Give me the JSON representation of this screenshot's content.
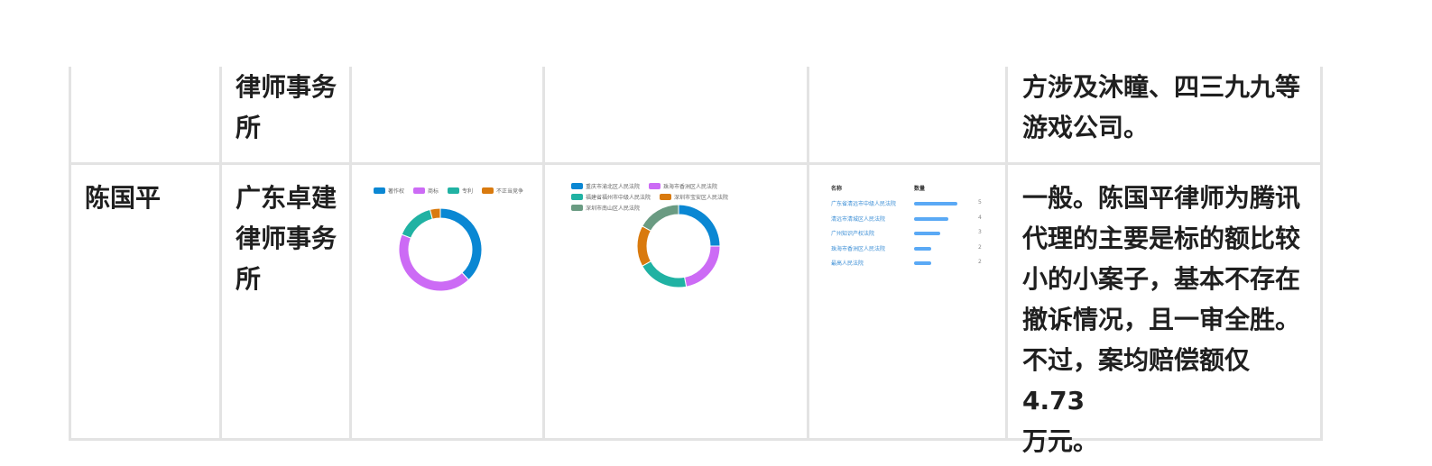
{
  "row_partial": {
    "firm_lines": [
      "律师事务",
      "所"
    ],
    "note_lines": [
      "方涉及沐瞳、四三九九等",
      "游戏公司。"
    ]
  },
  "row_main": {
    "name": "陈国平",
    "firm_lines": [
      "广东卓建",
      "律师事务",
      "所"
    ],
    "note_lines": [
      "一般。陈国平律师为腾讯",
      "代理的主要是标的额比较",
      "小的小案子，基本不存在",
      "撤诉情况，且一审全胜。",
      "不过，案均赔偿额仅4.73",
      "万元。"
    ]
  },
  "chart_data": [
    {
      "type": "pie",
      "variant": "donut",
      "labels": [
        "著作权",
        "商标",
        "专利",
        "不正当竞争"
      ],
      "values": [
        38,
        43,
        15,
        4
      ],
      "colors": [
        "#0a87d3",
        "#cc6bf5",
        "#20b2a3",
        "#d97a0e"
      ],
      "legend": "top"
    },
    {
      "type": "pie",
      "variant": "donut",
      "labels": [
        "重庆市渝北区人民法院",
        "珠海市香洲区人民法院",
        "福建省福州市中级人民法院",
        "深圳市宝安区人民法院",
        "深圳市南山区人民法院"
      ],
      "values": [
        25,
        22,
        20,
        16,
        17
      ],
      "colors": [
        "#0a87d3",
        "#cc6bf5",
        "#20b2a3",
        "#d97a0e",
        "#6a9b82"
      ],
      "legend": "top"
    },
    {
      "type": "bar",
      "orientation": "horizontal",
      "headers": [
        "名称",
        "数量"
      ],
      "categories": [
        "广东省清远市中级人民法院",
        "清远市清城区人民法院",
        "广州知识产权法院",
        "珠海市香洲区人民法院",
        "最高人民法院"
      ],
      "values": [
        5,
        4,
        3,
        2,
        2
      ],
      "color": "#5aa9f5"
    }
  ]
}
